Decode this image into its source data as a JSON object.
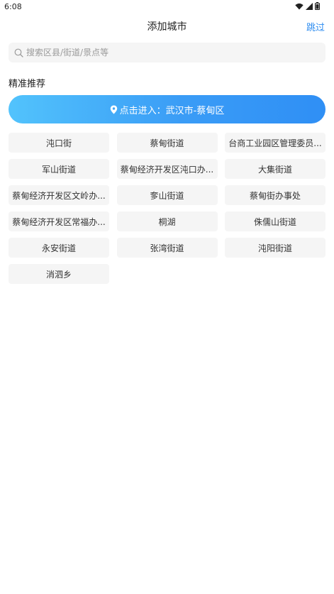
{
  "status_bar": {
    "time": "6:08"
  },
  "header": {
    "title": "添加城市",
    "skip_label": "跳过"
  },
  "search": {
    "placeholder": "搜索区县/街道/景点等",
    "value": ""
  },
  "recommend": {
    "section_title": "精准推荐",
    "enter_label": "点击进入：武汉市-蔡甸区",
    "items": [
      "沌口街",
      "蔡甸街道",
      "台商工业园区管理委员...",
      "军山街道",
      "蔡甸经济开发区沌口办...",
      "大集街道",
      "蔡甸经济开发区文岭办...",
      "奓山街道",
      "蔡甸街办事处",
      "蔡甸经济开发区常福办...",
      "桐湖",
      "侏儒山街道",
      "永安街道",
      "张湾街道",
      "沌阳街道",
      "消泗乡"
    ]
  },
  "colors": {
    "accent": "#2d8cf0",
    "button_gradient_start": "#52c3fc",
    "button_gradient_end": "#2f8ff5",
    "chip_background": "#f5f5f5"
  }
}
